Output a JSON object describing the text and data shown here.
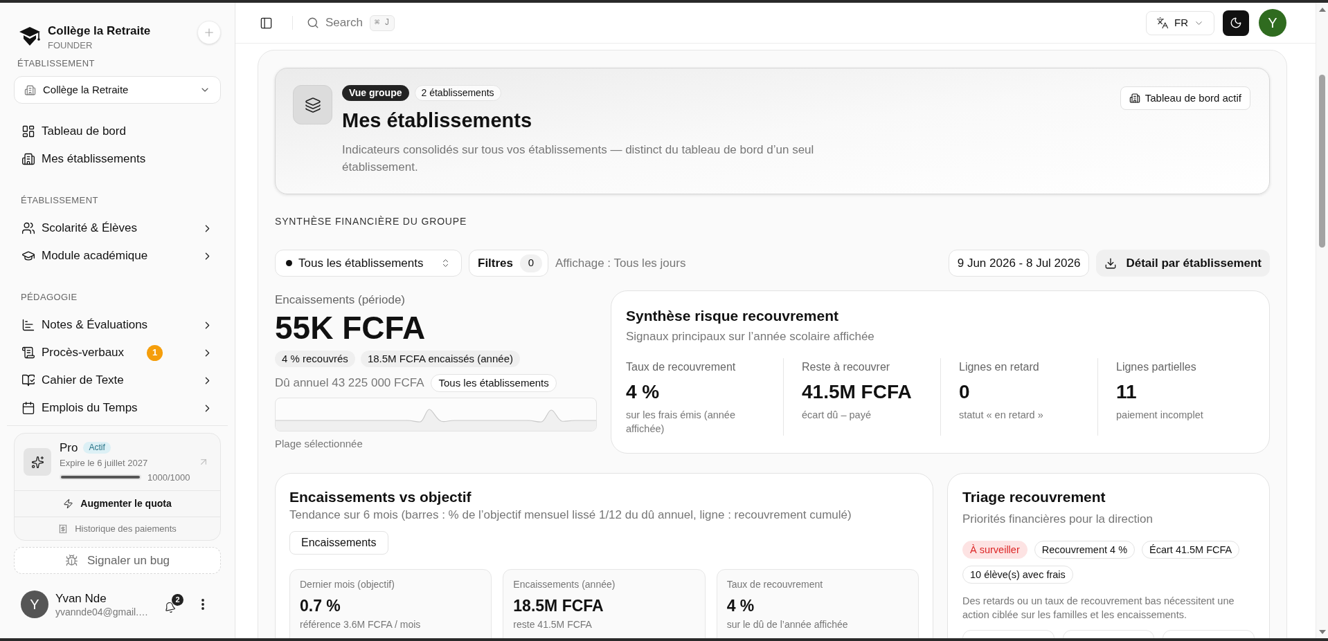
{
  "sidebar": {
    "org": {
      "name": "Collège la Retraite",
      "role": "FOUNDER"
    },
    "switcher": {
      "label": "ÉTABLISSEMENT",
      "value": "Collège la Retraite"
    },
    "nav": [
      {
        "label": "Tableau de bord",
        "selected": false
      },
      {
        "label": "Mes établissements",
        "selected": false
      }
    ],
    "sections": [
      {
        "title": "ÉTABLISSEMENT",
        "items": [
          {
            "label": "Scolarité & Élèves",
            "expanded": false
          },
          {
            "label": "Module académique",
            "expanded": false
          }
        ]
      },
      {
        "title": "PÉDAGOGIE",
        "items": [
          {
            "label": "Notes & Évaluations",
            "expanded": false
          },
          {
            "label": "Procès-verbaux",
            "badge": "1",
            "expanded": false
          },
          {
            "label": "Cahier de Texte",
            "expanded": false
          },
          {
            "label": "Emplois du Temps",
            "expanded": false
          }
        ]
      }
    ],
    "plan": {
      "name": "Pro",
      "status": "Actif",
      "expiry": "Expire le 6 juillet 2027",
      "quota": {
        "level": 1,
        "reading": "1000/1000"
      },
      "upgrade": "Augmenter le quota",
      "history": "Historique des paiements"
    },
    "bug_report": "Signaler un bug",
    "user": {
      "initial": "Y",
      "name": "Yvan Nde",
      "email": "yvannde04@gmail.…",
      "notifications": "2"
    }
  },
  "header": {
    "search": {
      "label": "Search",
      "shortcut": "⌘ J"
    },
    "language": "FR",
    "avatar": "Y"
  },
  "hero": {
    "badges": [
      {
        "text": "Vue groupe",
        "kind": "solid"
      },
      {
        "text": "2 établissements",
        "kind": "outline"
      }
    ],
    "title": "Mes établissements",
    "description": "Indicateurs consolidés sur tous vos établissements — distinct du tableau de bord d’un seul établissement.",
    "action": "Tableau de bord actif"
  },
  "finance": {
    "section_title": "SYNTHÈSE FINANCIÈRE DU GROUPE",
    "scope": "Tous les établissements",
    "filters": {
      "label": "Filtres",
      "count": "0"
    },
    "display": "Affichage : Tous les jours",
    "date_range": "9 Jun 2026 - 8 Jul 2026",
    "export": "Détail par établissement",
    "collections": {
      "label": "Encaissements (période)",
      "value": "55K FCFA",
      "pills": [
        "4 % recouvrés",
        "18.5M FCFA encaissés (année)"
      ],
      "annual_due": "Dû annuel 43 225 000 FCFA",
      "scope": "Tous les établissements",
      "range_caption": "Plage sélectionnée"
    },
    "risk": {
      "title": "Synthèse risque recouvrement",
      "subtitle": "Signaux principaux sur l’année scolaire affichée",
      "metrics": [
        {
          "label": "Taux de recouvrement",
          "value": "4 %",
          "note": "sur les frais émis (année affichée)"
        },
        {
          "label": "Reste à recouvrer",
          "value": "41.5M FCFA",
          "note": "écart dû – payé"
        },
        {
          "label": "Lignes en retard",
          "value": "0",
          "note": "statut « en retard »"
        },
        {
          "label": "Lignes partielles",
          "value": "11",
          "note": "paiement incomplet"
        }
      ]
    },
    "objective": {
      "title": "Encaissements vs objectif",
      "subtitle": "Tendance sur 6 mois (barres : % de l’objectif mensuel lissé 1/12 du dû annuel, ligne : recouvrement cumulé)",
      "toggle": "Encaissements",
      "stats": [
        {
          "label": "Dernier mois (objectif)",
          "value": "0.7 %",
          "note": "référence 3.6M FCFA / mois"
        },
        {
          "label": "Encaissements (année)",
          "value": "18.5M FCFA",
          "note": "reste 41.5M FCFA"
        },
        {
          "label": "Taux de recouvrement",
          "value": "4 %",
          "note": "sur le dû de l’année affichée"
        }
      ]
    },
    "triage": {
      "title": "Triage recouvrement",
      "subtitle": "Priorités financières pour la direction",
      "tags": [
        {
          "text": "À surveiller",
          "kind": "alert"
        },
        {
          "text": "Recouvrement 4 %",
          "kind": "neutral"
        },
        {
          "text": "Écart 41.5M FCFA",
          "kind": "neutral"
        },
        {
          "text": "10 élève(s) avec frais",
          "kind": "neutral"
        }
      ],
      "note": "Des retards ou un taux de recouvrement bas nécessitent une action ciblée sur les familles et les encaissements."
    }
  }
}
